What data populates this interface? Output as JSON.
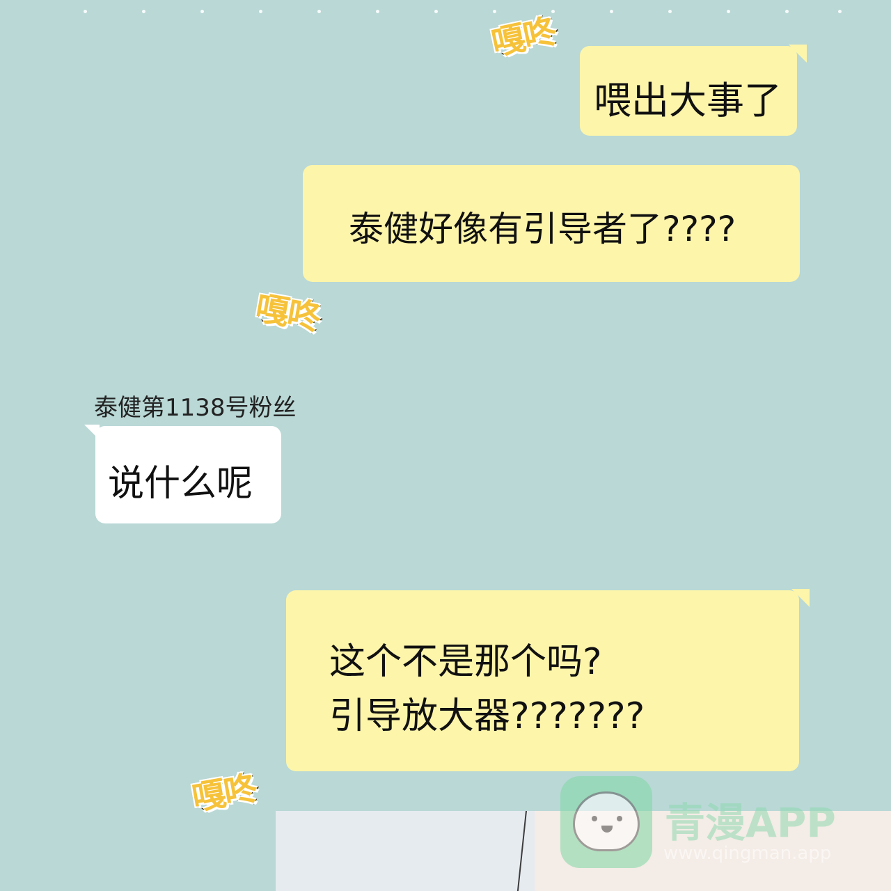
{
  "sound_effect": "嘎咚",
  "messages": [
    {
      "from": "self",
      "lines": [
        "喂出大事了"
      ]
    },
    {
      "from": "self",
      "lines": [
        "泰健好像有引导者了????"
      ]
    },
    {
      "from": "other",
      "sender": "泰健第1138号粉丝",
      "lines": [
        "说什么呢"
      ]
    },
    {
      "from": "self",
      "lines": [
        "这个不是那个吗?",
        "引导放大器???????"
      ]
    }
  ],
  "watermark": {
    "title": "青漫APP",
    "url": "www.qingman.app",
    "icon": "cat-face-icon"
  },
  "colors": {
    "background": "#b9d8d6",
    "self_bubble": "#fdf5aa",
    "other_bubble": "#ffffff",
    "sfx_fill": "#f6c23a",
    "sfx_outline": "#3a2412"
  }
}
